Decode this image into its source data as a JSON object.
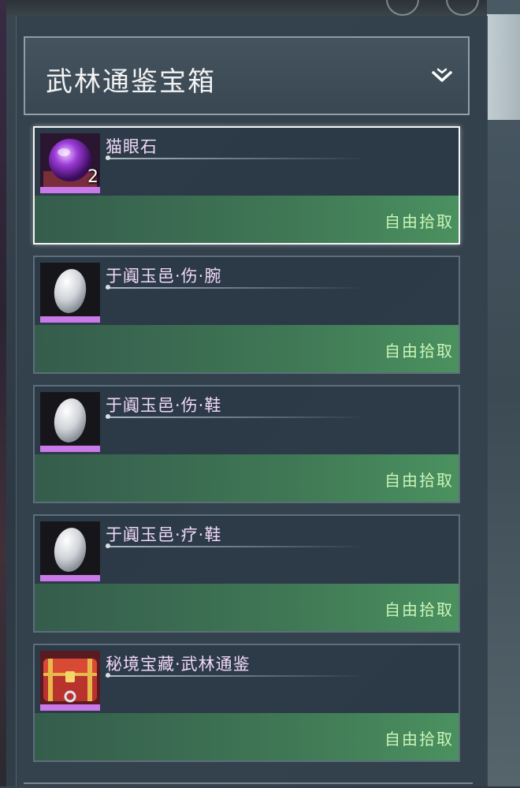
{
  "header": {
    "title": "武林通鉴宝箱"
  },
  "items": [
    {
      "name": "猫眼石",
      "count": "2",
      "action": "自由拾取",
      "icon": "cat-eye-gem-icon",
      "rarity_color": "#c97ae8",
      "selected": true
    },
    {
      "name": "于阗玉邑·伤·腕",
      "count": "",
      "action": "自由拾取",
      "icon": "jade-stone-icon",
      "rarity_color": "#c97ae8",
      "selected": false
    },
    {
      "name": "于阗玉邑·伤·鞋",
      "count": "",
      "action": "自由拾取",
      "icon": "jade-stone-icon",
      "rarity_color": "#c97ae8",
      "selected": false
    },
    {
      "name": "于阗玉邑·疗·鞋",
      "count": "",
      "action": "自由拾取",
      "icon": "jade-stone-icon",
      "rarity_color": "#c97ae8",
      "selected": false
    },
    {
      "name": "秘境宝藏·武林通鉴",
      "count": "",
      "action": "自由拾取",
      "icon": "treasure-chest-icon",
      "rarity_color": "#c97ae8",
      "selected": false
    }
  ]
}
